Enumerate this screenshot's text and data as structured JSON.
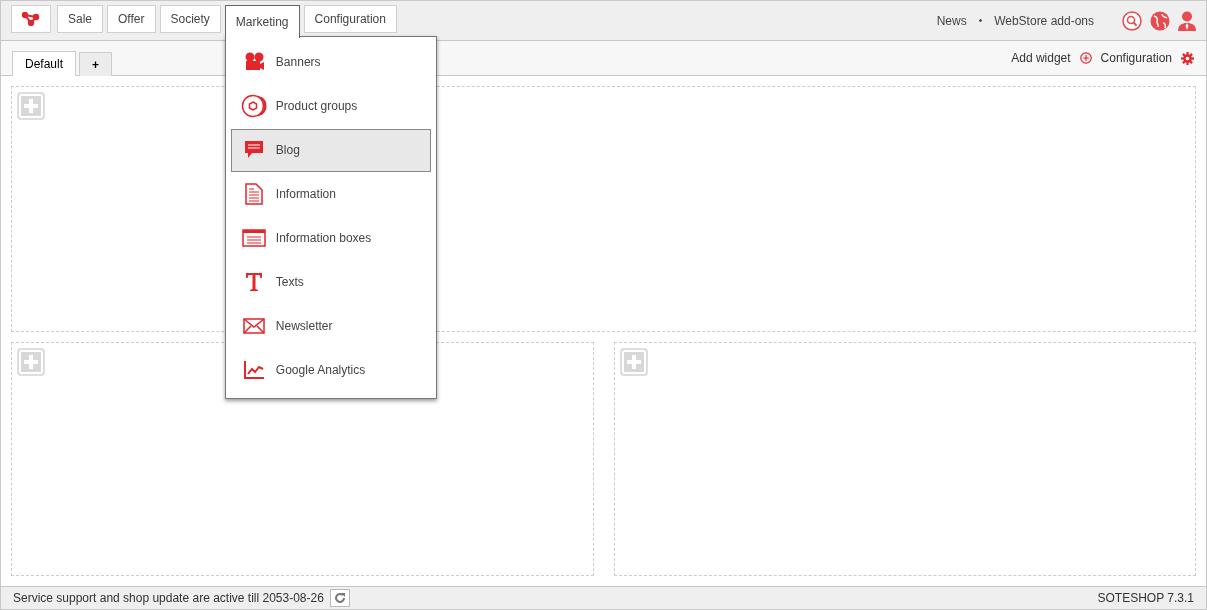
{
  "nav": [
    {
      "label": "Sale",
      "selected": false
    },
    {
      "label": "Offer",
      "selected": false
    },
    {
      "label": "Society",
      "selected": false
    },
    {
      "label": "Marketing",
      "selected": true
    },
    {
      "label": "Configuration",
      "selected": false
    }
  ],
  "header_links": [
    "News",
    "•",
    "WebStore add-ons"
  ],
  "dropdown": [
    {
      "kind": "camera",
      "label": "Banners",
      "selected": false
    },
    {
      "kind": "groups",
      "label": "Product groups",
      "selected": false
    },
    {
      "kind": "comment",
      "label": "Blog",
      "selected": true
    },
    {
      "kind": "document",
      "label": "Information",
      "selected": false
    },
    {
      "kind": "box",
      "label": "Information boxes",
      "selected": false
    },
    {
      "kind": "text",
      "label": "Texts",
      "selected": false
    },
    {
      "kind": "mail",
      "label": "Newsletter",
      "selected": false
    },
    {
      "kind": "chart",
      "label": "Google Analytics",
      "selected": false
    }
  ],
  "dashboard_tabs": [
    {
      "label": "Default",
      "selected": true
    },
    {
      "label": "+",
      "selected": false
    }
  ],
  "toolbar": {
    "add_widget": "Add widget",
    "configuration": "Configuration"
  },
  "status_bar": {
    "message": "Service support and shop update are active till 2053-08-26",
    "version": "SOTESHOP 7.3.1"
  }
}
